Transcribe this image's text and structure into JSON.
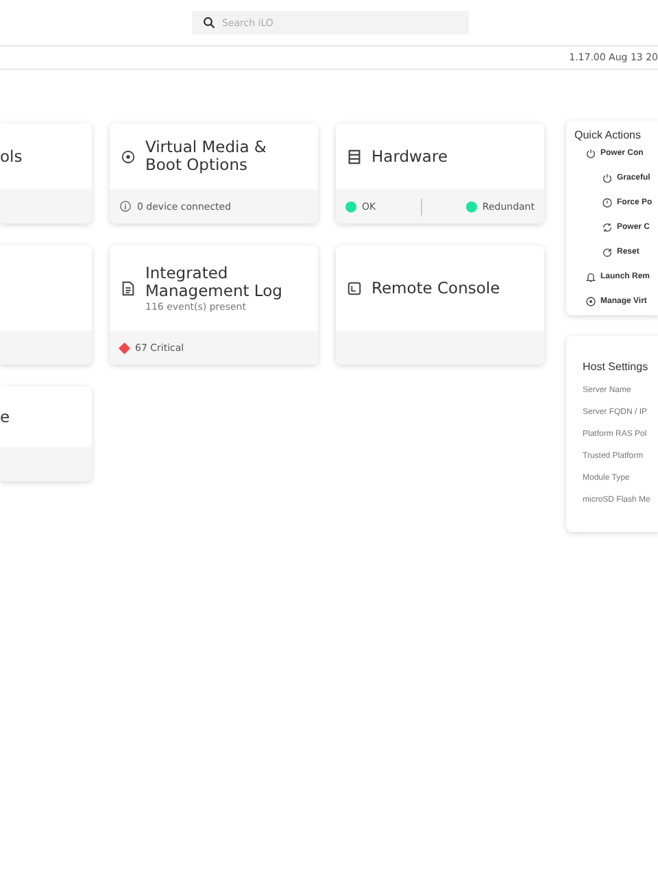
{
  "search": {
    "placeholder": "Search iLO"
  },
  "version": "1.17.00 Aug 13 20",
  "card_rows": [
    {
      "cards": [
        {
          "kind": "partial",
          "title": "ols"
        },
        {
          "kind": "full",
          "title": "Virtual Media & Boot Options",
          "footer": [
            {
              "kind": "info",
              "text": "0 device connected"
            }
          ]
        },
        {
          "kind": "full",
          "title": "Hardware",
          "footer": [
            {
              "kind": "dot",
              "color": "#1de39b",
              "text": "OK"
            },
            {
              "kind": "dot",
              "color": "#1de39b",
              "text": "Redundant"
            }
          ]
        }
      ]
    },
    {
      "cards": [
        {
          "kind": "partial"
        },
        {
          "kind": "full",
          "title": "Integrated Management Log",
          "subtitle": "116 event(s) present",
          "footer": [
            {
              "kind": "diamond",
              "color": "#f2484d",
              "text": "67 Critical"
            }
          ]
        },
        {
          "kind": "full",
          "title": "Remote Console"
        }
      ]
    },
    {
      "cards": [
        {
          "kind": "partial",
          "title": "e"
        }
      ]
    }
  ],
  "quick_actions": {
    "title": "Quick Actions",
    "items": [
      {
        "label": "Power Con",
        "children": [
          {
            "label": "Graceful"
          },
          {
            "label": "Force Po"
          },
          {
            "label": "Power C"
          },
          {
            "label": "Reset"
          }
        ]
      },
      {
        "label": "Launch Rem"
      },
      {
        "label": "Manage Virt"
      }
    ]
  },
  "host_settings": {
    "title": "Host Settings",
    "labels": [
      "Server Name",
      "Server FQDN / IP",
      "Platform RAS Pol",
      "Trusted Platform",
      "Module Type",
      "microSD Flash Me"
    ]
  }
}
